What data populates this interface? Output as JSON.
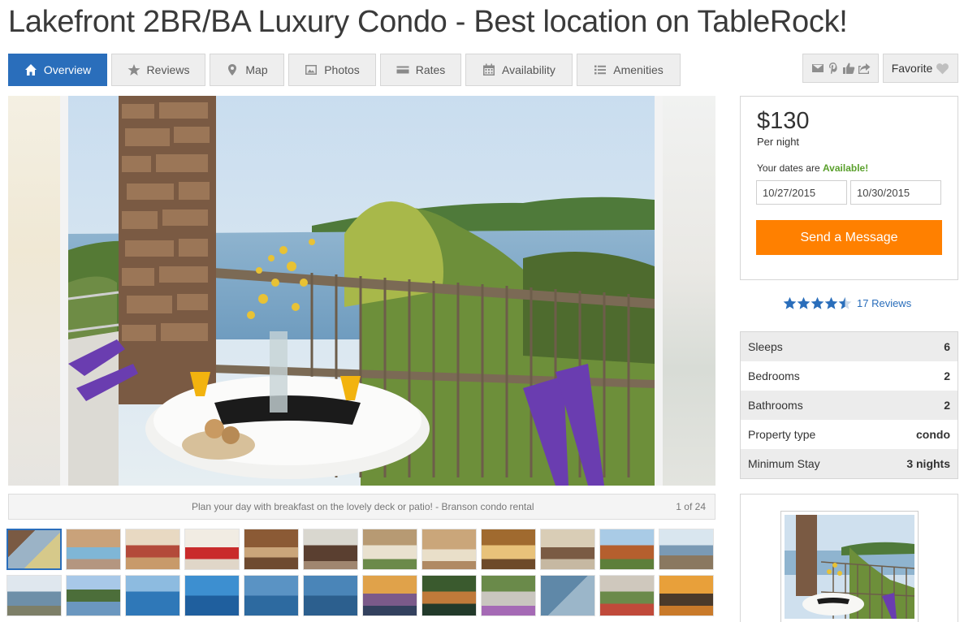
{
  "listing": {
    "title": "Lakefront 2BR/BA Luxury Condo - Best location on TableRock!"
  },
  "tabs": [
    {
      "label": "Overview",
      "icon": "home-icon",
      "active": true
    },
    {
      "label": "Reviews",
      "icon": "star-icon"
    },
    {
      "label": "Map",
      "icon": "map-pin-icon"
    },
    {
      "label": "Photos",
      "icon": "photo-icon"
    },
    {
      "label": "Rates",
      "icon": "rates-icon"
    },
    {
      "label": "Availability",
      "icon": "calendar-icon"
    },
    {
      "label": "Amenities",
      "icon": "list-icon"
    }
  ],
  "share": {
    "icons": [
      "email-icon",
      "pinterest-icon",
      "thumbs-up-icon",
      "share-icon"
    ]
  },
  "favorite": {
    "label": "Favorite",
    "icon": "heart-icon"
  },
  "gallery": {
    "caption": "Plan your day with breakfast on the lovely deck or patio! - Branson condo rental",
    "counter": "1 of 24",
    "thumbnail_count": 24,
    "selected_index": 0
  },
  "booking": {
    "price": "$130",
    "per": "Per night",
    "dates_prefix": "Your dates are ",
    "dates_status": "Available!",
    "checkin": "10/27/2015",
    "checkout": "10/30/2015",
    "send_label": "Send a Message",
    "send_color": "#ff8000",
    "available_color": "#5aa02c"
  },
  "rating": {
    "stars": 4.5,
    "reviews_label": "17 Reviews",
    "star_color": "#2a6ebb"
  },
  "facts": [
    {
      "label": "Sleeps",
      "value": "6"
    },
    {
      "label": "Bedrooms",
      "value": "2"
    },
    {
      "label": "Bathrooms",
      "value": "2"
    },
    {
      "label": "Property type",
      "value": "condo"
    },
    {
      "label": "Minimum Stay",
      "value": "3 nights"
    }
  ],
  "colors": {
    "accent": "#2a6ebb",
    "tab_bg": "#eeeeee"
  }
}
